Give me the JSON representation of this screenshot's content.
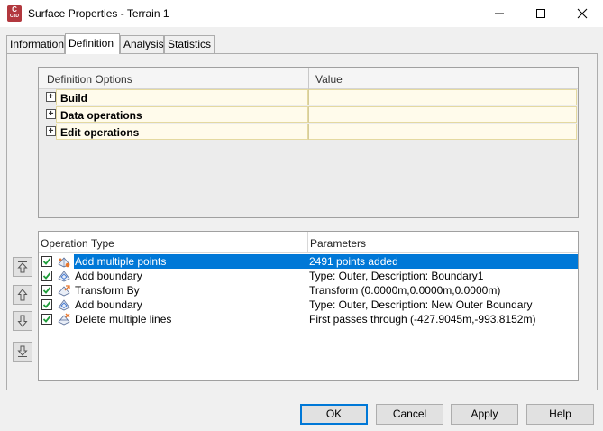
{
  "window": {
    "title": "Surface Properties - Terrain 1",
    "app_icon_letter": "C",
    "app_icon_sub": "C3D",
    "controls": [
      "minimize-icon",
      "maximize-icon",
      "close-icon"
    ]
  },
  "tabs": [
    {
      "label": "Information",
      "active": false
    },
    {
      "label": "Definition",
      "active": true
    },
    {
      "label": "Analysis",
      "active": false
    },
    {
      "label": "Statistics",
      "active": false
    }
  ],
  "definition_options": {
    "columns": [
      "Definition Options",
      "Value"
    ],
    "rows": [
      {
        "label": "Build",
        "value": ""
      },
      {
        "label": "Data operations",
        "value": ""
      },
      {
        "label": "Edit operations",
        "value": ""
      }
    ]
  },
  "operations": {
    "columns": [
      "Operation Type",
      "Parameters"
    ],
    "rows": [
      {
        "type": "Add multiple points",
        "params": "2491 points added",
        "checked": true,
        "selected": true,
        "icon": "points-icon"
      },
      {
        "type": "Add boundary",
        "params": "Type: Outer,  Description: Boundary1",
        "checked": true,
        "selected": false,
        "icon": "boundary-icon"
      },
      {
        "type": "Transform By",
        "params": "Transform (0.0000m,0.0000m,0.0000m)",
        "checked": true,
        "selected": false,
        "icon": "transform-icon"
      },
      {
        "type": "Add boundary",
        "params": "Type: Outer,  Description: New Outer Boundary",
        "checked": true,
        "selected": false,
        "icon": "boundary-icon"
      },
      {
        "type": "Delete multiple lines",
        "params": "First passes through (-427.9045m,-993.8152m)",
        "checked": true,
        "selected": false,
        "icon": "delete-lines-icon"
      }
    ]
  },
  "side_buttons": [
    "move-to-top-icon",
    "move-up-icon",
    "move-down-icon",
    "move-to-bottom-icon"
  ],
  "buttons": {
    "ok": "OK",
    "cancel": "Cancel",
    "apply": "Apply",
    "help": "Help"
  },
  "colors": {
    "selection": "#0078d7",
    "option_row_bg": "#fffbeb",
    "check_green": "#1f9d3a",
    "app_icon": "#b2383e"
  }
}
